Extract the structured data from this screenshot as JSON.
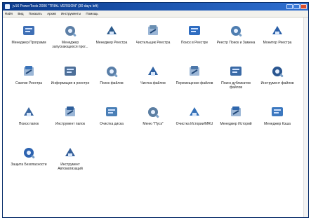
{
  "window": {
    "title": "jv16 PowerTools 2006 \"TRIAL VERSION\" (30 days left)"
  },
  "menu": [
    "Файл",
    "Вид",
    "Показать",
    "Архив",
    "Инструменты",
    "Помощь"
  ],
  "tools": [
    {
      "label": "Менеджер Программ",
      "icon": "program-manager-icon",
      "color": "#3f6fb5"
    },
    {
      "label": "Менеджер запускающихся прог...",
      "icon": "startup-manager-icon",
      "color": "#5c7fa6"
    },
    {
      "label": "Менеджер Реестра",
      "icon": "registry-manager-icon",
      "color": "#2d5b8c"
    },
    {
      "label": "Чистильщик Реестра",
      "icon": "registry-cleaner-icon",
      "color": "#6a8fb2"
    },
    {
      "label": "Поиск в Реестре",
      "icon": "registry-search-icon",
      "color": "#2e6cc0"
    },
    {
      "label": "Реестр Поиск и Замена",
      "icon": "registry-replace-icon",
      "color": "#4e7db0"
    },
    {
      "label": "Монитор Реестра",
      "icon": "registry-monitor-icon",
      "color": "#2a5fa8"
    },
    {
      "label": "Сжатие Реестра",
      "icon": "registry-compactor-icon",
      "color": "#3b73b8"
    },
    {
      "label": "Информация в реестре",
      "icon": "registry-info-icon",
      "color": "#4d6f98"
    },
    {
      "label": "Поиск файлов",
      "icon": "file-finder-icon",
      "color": "#5a7fa8"
    },
    {
      "label": "Чистка файлов",
      "icon": "file-cleaner-icon",
      "color": "#2f62a3"
    },
    {
      "label": "Перемещение файлов",
      "icon": "file-mover-icon",
      "color": "#4b76a9"
    },
    {
      "label": "Поиск дубликатов файлов",
      "icon": "duplicate-finder-icon",
      "color": "#3a6aa6"
    },
    {
      "label": "Инструмент файлов",
      "icon": "file-tools-icon",
      "color": "#2a5690"
    },
    {
      "label": "Поиск папок",
      "icon": "folder-finder-icon",
      "color": "#3b67a0"
    },
    {
      "label": "Инструмент папок",
      "icon": "folder-tools-icon",
      "color": "#2f5f9b"
    },
    {
      "label": "Очистка диска",
      "icon": "disk-cleaner-icon",
      "color": "#4a7fb6"
    },
    {
      "label": "Меню \"Пуск\"",
      "icon": "start-menu-icon",
      "color": "#5b7ea2"
    },
    {
      "label": "Очистка Истории/MRU",
      "icon": "history-cleaner-icon",
      "color": "#3571b8"
    },
    {
      "label": "Менеджер Историй",
      "icon": "history-manager-icon",
      "color": "#2f67ad"
    },
    {
      "label": "Менеджер Кэша",
      "icon": "cache-manager-icon",
      "color": "#3c78bf"
    },
    {
      "label": "Защита Безопасности",
      "icon": "security-shield-icon",
      "color": "#2d63b0"
    },
    {
      "label": "Инструмент Автоматизаций",
      "icon": "automation-tools-icon",
      "color": "#355f99"
    }
  ]
}
